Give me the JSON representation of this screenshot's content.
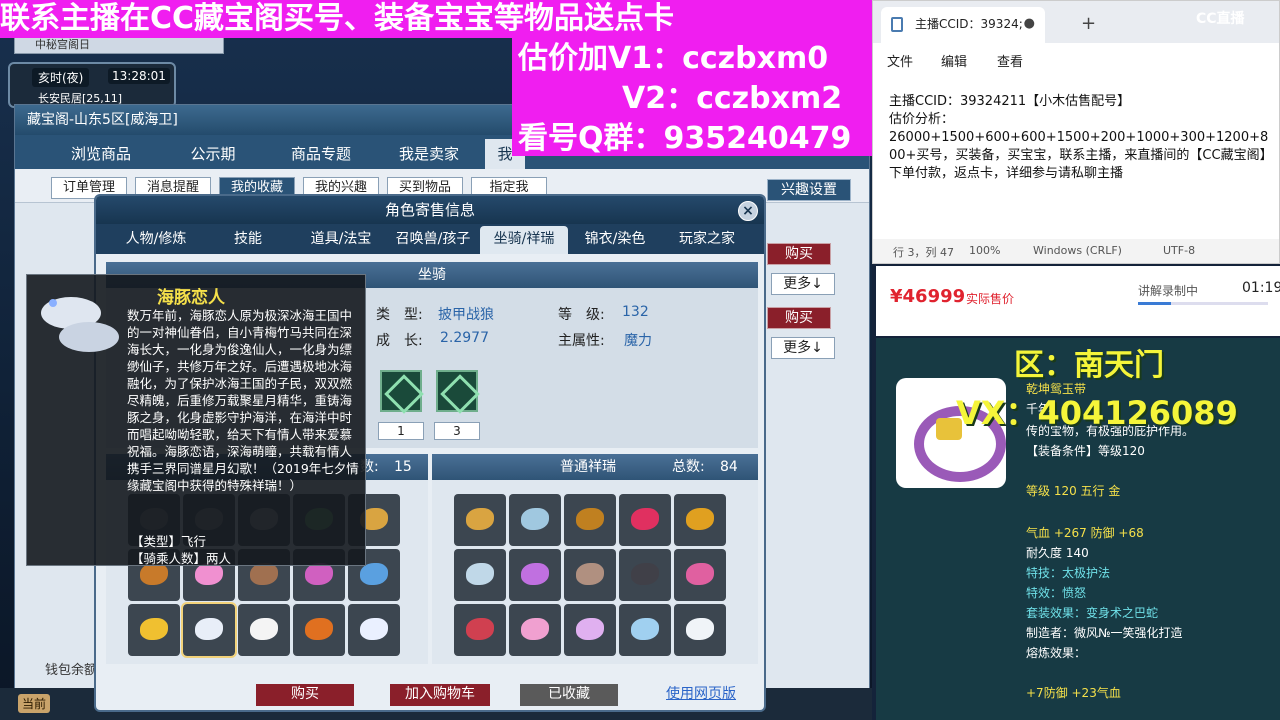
{
  "game": {
    "browser_tab": "中秘宫阁日",
    "clock_period": "亥时(夜)",
    "clock_time": "13:28:01",
    "location": "长安民居[25,11]",
    "bottom_current": "当前"
  },
  "shop": {
    "title": "藏宝阁-山东5区[威海卫]",
    "tabs": [
      "浏览商品",
      "公示期",
      "商品专题",
      "我是卖家",
      "我"
    ],
    "sub_tabs": [
      "订单管理",
      "消息提醒",
      "我的收藏",
      "我的兴趣",
      "买到物品",
      "指定我"
    ],
    "interest_settings": "兴趣设置",
    "side_buy": "购买",
    "side_more": "更多↓",
    "wallet": "钱包余额"
  },
  "role_dialog": {
    "title": "角色寄售信息",
    "tabs": [
      "人物/修炼",
      "技能",
      "道具/法宝",
      "召唤兽/孩子",
      "坐骑/祥瑞",
      "锦衣/染色",
      "玩家之家"
    ],
    "active_tab": "坐骑/祥瑞",
    "section": "坐骑",
    "mount": {
      "type_label": "类　型:",
      "type_value": "披甲战狼",
      "level_label": "等　级:",
      "level_value": "132",
      "growth_label": "成　长:",
      "growth_value": "2.2977",
      "attr_label": "主属性:",
      "attr_value": "魔力",
      "skill_counts": [
        "1",
        "3"
      ]
    },
    "left_list": {
      "total_label": "数:",
      "total": "15"
    },
    "right_list": {
      "title": "普通祥瑞",
      "total_label": "总数:",
      "total": "84"
    },
    "buttons": {
      "buy": "购买",
      "add_cart": "加入购物车",
      "favorited": "已收藏",
      "web_page": "使用网页版"
    }
  },
  "tooltip": {
    "name": "海豚恋人",
    "desc": "数万年前，海豚恋人原为极深冰海王国中的一对神仙眷侣，自小青梅竹马共同在深海长大，一化身为俊逸仙人，一化身为缥缈仙子，共修万年之好。后遭遇极地冰海融化，为了保护冰海王国的子民，双双燃尽精魄，后重修万载聚星月精华，重铸海豚之身，化身虚影守护海洋，在海洋中时而唱起呦呦轻歌，给天下有情人带来爱慕祝福。海豚恋语，深海萌瞳，共载有情人携手三界同谱星月幻歌！（2019年七夕情缘藏宝阁中获得的特殊祥瑞！）",
    "type_line": "【类型】飞行",
    "riders_line": "【骑乘人数】两人"
  },
  "overlay": {
    "headline": "联系主播在CC藏宝阁买号、装备宝宝等物品送点卡",
    "line1": "估价加V1：cczbxm0",
    "line2": "V2：cczbxm2",
    "line3": "看号Q群：935240479"
  },
  "notepad": {
    "tab_title": "主播CCID：39324;",
    "new_tab": "+",
    "menu": [
      "文件",
      "编辑",
      "查看"
    ],
    "line1": "主播CCID：39324211【小木估售配号】",
    "line2": "估价分析：",
    "line3": "26000+1500+600+600+1500+200+1000+300+1200+800+买号，买装备，买宝宝，联系主播，来直播间的【CC藏宝阁】下单付款，返点卡，详细参与请私聊主播",
    "status": [
      "行 3，列 47",
      "100%",
      "Windows (CRLF)",
      "UTF-8"
    ]
  },
  "watermark": "CC直播",
  "price_bar": {
    "price": "¥46999",
    "price_label": "实际售价",
    "recording": "讲解录制中",
    "time": "01:19",
    "progress": 0.25
  },
  "equipment": {
    "region": "区：南天门",
    "vx": "VX：404126089",
    "name": "乾坤鸳玉带",
    "desc1": "千年",
    "desc2": "传的宝物，有极强的庇护作用。",
    "req": "【装备条件】等级120",
    "level": "等级 120 五行 金",
    "stats": "气血 +267 防御 +68",
    "durability": "耐久度 140",
    "special_skill": "特技：太极护法",
    "special_effect": "特效：愤怒",
    "set_effect": "套装效果：变身术之巴蛇",
    "maker": "制造者：微风№一笑强化打造",
    "forge": "熔炼效果：",
    "forge_stats": "+7防御 +23气血"
  }
}
